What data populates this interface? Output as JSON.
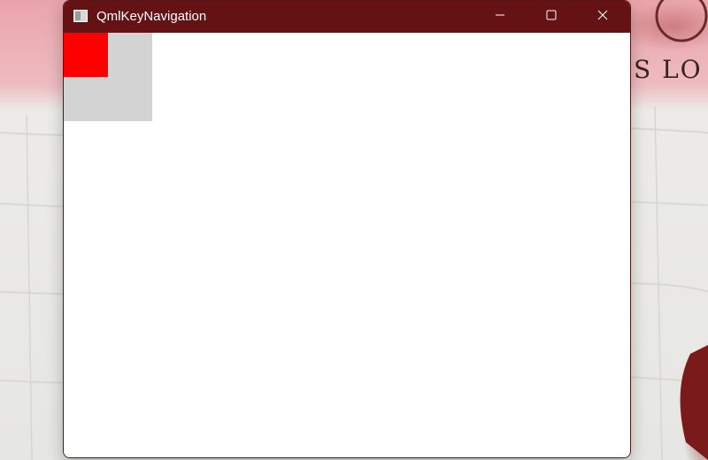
{
  "window": {
    "title": "QmlKeyNavigation",
    "titlebar_color": "#641214"
  },
  "titlebar": {
    "icon": "app-window-icon",
    "buttons": [
      {
        "name": "minimize",
        "icon": "minimize-icon"
      },
      {
        "name": "maximize",
        "icon": "maximize-icon"
      },
      {
        "name": "close",
        "icon": "close-icon"
      }
    ]
  },
  "content": {
    "background_color": "#ffffff",
    "items": [
      {
        "name": "gray-square",
        "color": "#d3d3d3"
      },
      {
        "name": "red-square",
        "color": "#ff0000",
        "focused": true
      }
    ]
  },
  "desktop": {
    "wall_text": "S LO"
  }
}
